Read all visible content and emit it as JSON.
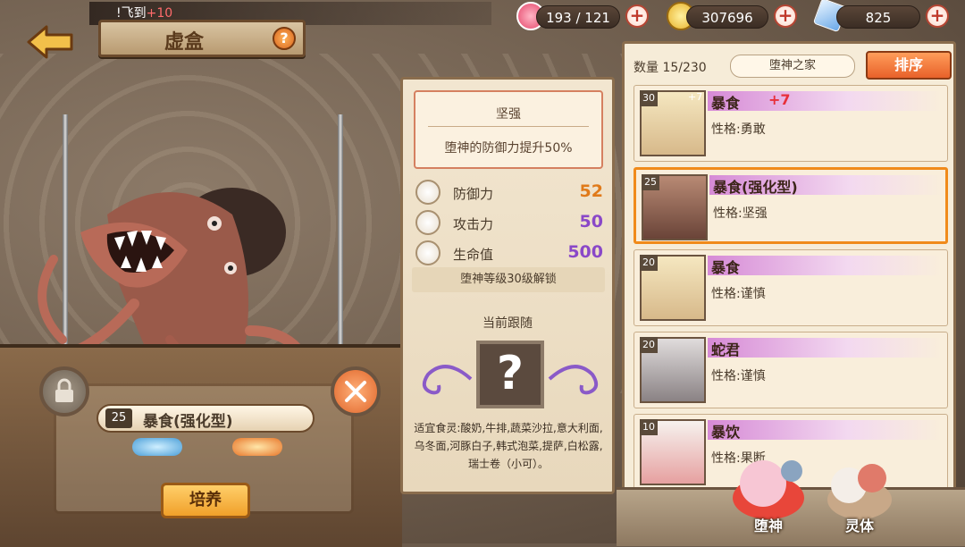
{
  "ticker": {
    "text": "!飞到",
    "highlight": "+10"
  },
  "resources": {
    "stamina": "193 / 121",
    "coins": "307696",
    "crystals": "825"
  },
  "header": {
    "title": "虚盒",
    "help_label": "?",
    "plus_label": "+"
  },
  "left": {
    "selected_level": "25",
    "selected_name": "暴食(强化型)",
    "cultivate_label": "培养"
  },
  "skill": {
    "name": "坚强",
    "desc": "堕神的防御力提升50%"
  },
  "stats": [
    {
      "label": "防御力",
      "value": "52",
      "color": "#e07a1a"
    },
    {
      "label": "攻击力",
      "value": "50",
      "color": "#8a48c8"
    },
    {
      "label": "生命值",
      "value": "500",
      "color": "#8a48c8"
    }
  ],
  "unlock_text": "堕神等级30级解锁",
  "follow": {
    "label": "当前跟随",
    "slot": "?",
    "food_text": "适宜食灵:酸奶,牛排,蔬菜沙拉,意大利面,乌冬面,河豚白子,韩式泡菜,提萨,白松露,瑞士卷（小可）。"
  },
  "panel": {
    "count_label": "数量",
    "count": "15/230",
    "home": "堕神之家",
    "sort": "排序"
  },
  "cards": [
    {
      "level": "30",
      "plus": "+7",
      "name": "暴食",
      "extra": "+7",
      "trait": "性格:勇敢",
      "selected": false
    },
    {
      "level": "25",
      "plus": "",
      "name": "暴食(强化型)",
      "extra": "",
      "trait": "性格:坚强",
      "selected": true
    },
    {
      "level": "20",
      "plus": "",
      "name": "暴食",
      "extra": "",
      "trait": "性格:谨慎",
      "selected": false
    },
    {
      "level": "20",
      "plus": "",
      "name": "蛇君",
      "extra": "",
      "trait": "性格:谨慎",
      "selected": false
    },
    {
      "level": "10",
      "plus": "",
      "name": "暴饮",
      "extra": "",
      "trait": "性格:果断",
      "selected": false
    }
  ],
  "tabs": {
    "fallen": "堕神",
    "spirit": "灵体"
  }
}
